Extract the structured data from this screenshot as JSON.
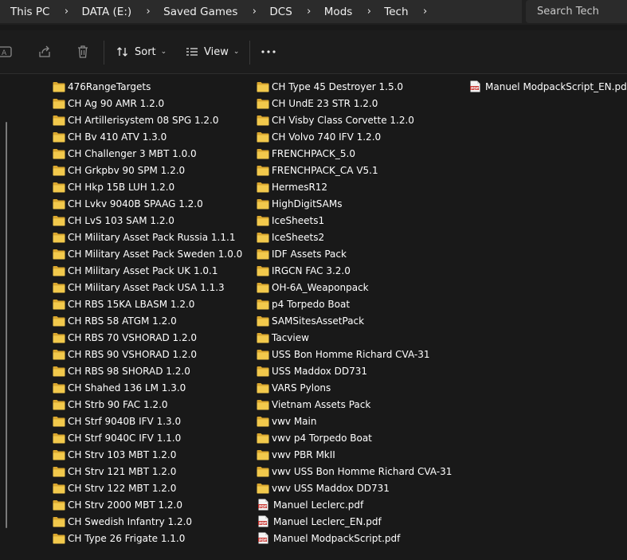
{
  "breadcrumb": [
    "This PC",
    "DATA (E:)",
    "Saved Games",
    "DCS",
    "Mods",
    "Tech"
  ],
  "search": {
    "placeholder": "Search Tech"
  },
  "toolbar": {
    "sort_label": "Sort",
    "view_label": "View",
    "more_label": "..."
  },
  "files": {
    "column1": [
      {
        "name": "476RangeTargets",
        "type": "folder"
      },
      {
        "name": "CH Ag 90 AMR 1.2.0",
        "type": "folder"
      },
      {
        "name": "CH Artillerisystem 08 SPG 1.2.0",
        "type": "folder"
      },
      {
        "name": "CH Bv 410 ATV 1.3.0",
        "type": "folder"
      },
      {
        "name": "CH Challenger 3 MBT 1.0.0",
        "type": "folder"
      },
      {
        "name": "CH Grkpbv 90 SPM 1.2.0",
        "type": "folder"
      },
      {
        "name": "CH Hkp 15B LUH 1.2.0",
        "type": "folder"
      },
      {
        "name": "CH Lvkv 9040B SPAAG 1.2.0",
        "type": "folder"
      },
      {
        "name": "CH LvS 103 SAM 1.2.0",
        "type": "folder"
      },
      {
        "name": "CH Military Asset Pack Russia 1.1.1",
        "type": "folder"
      },
      {
        "name": "CH Military Asset Pack Sweden 1.0.0",
        "type": "folder"
      },
      {
        "name": "CH Military Asset Pack UK 1.0.1",
        "type": "folder"
      },
      {
        "name": "CH Military Asset Pack USA 1.1.3",
        "type": "folder"
      },
      {
        "name": "CH RBS 15KA LBASM 1.2.0",
        "type": "folder"
      },
      {
        "name": "CH RBS 58 ATGM 1.2.0",
        "type": "folder"
      },
      {
        "name": "CH RBS 70 VSHORAD 1.2.0",
        "type": "folder"
      },
      {
        "name": "CH RBS 90 VSHORAD 1.2.0",
        "type": "folder"
      },
      {
        "name": "CH RBS 98 SHORAD 1.2.0",
        "type": "folder"
      },
      {
        "name": "CH Shahed 136 LM 1.3.0",
        "type": "folder"
      },
      {
        "name": "CH Strb 90 FAC 1.2.0",
        "type": "folder"
      },
      {
        "name": "CH Strf 9040B IFV 1.3.0",
        "type": "folder"
      },
      {
        "name": "CH Strf 9040C IFV 1.1.0",
        "type": "folder"
      },
      {
        "name": "CH Strv 103 MBT 1.2.0",
        "type": "folder"
      },
      {
        "name": "CH Strv 121 MBT 1.2.0",
        "type": "folder"
      },
      {
        "name": "CH Strv 122 MBT 1.2.0",
        "type": "folder"
      },
      {
        "name": "CH Strv 2000 MBT 1.2.0",
        "type": "folder"
      },
      {
        "name": "CH Swedish Infantry 1.2.0",
        "type": "folder"
      },
      {
        "name": "CH Type 26 Frigate 1.1.0",
        "type": "folder"
      }
    ],
    "column2": [
      {
        "name": "CH Type 45 Destroyer 1.5.0",
        "type": "folder"
      },
      {
        "name": "CH UndE 23 STR 1.2.0",
        "type": "folder"
      },
      {
        "name": "CH Visby Class Corvette 1.2.0",
        "type": "folder"
      },
      {
        "name": "CH Volvo 740 IFV 1.2.0",
        "type": "folder"
      },
      {
        "name": "FRENCHPACK_5.0",
        "type": "folder"
      },
      {
        "name": "FRENCHPACK_CA V5.1",
        "type": "folder"
      },
      {
        "name": "HermesR12",
        "type": "folder"
      },
      {
        "name": "HighDigitSAMs",
        "type": "folder"
      },
      {
        "name": "IceSheets1",
        "type": "folder"
      },
      {
        "name": "IceSheets2",
        "type": "folder"
      },
      {
        "name": "IDF Assets Pack",
        "type": "folder"
      },
      {
        "name": "IRGCN FAC 3.2.0",
        "type": "folder"
      },
      {
        "name": "OH-6A_Weaponpack",
        "type": "folder"
      },
      {
        "name": "p4 Torpedo Boat",
        "type": "folder"
      },
      {
        "name": "SAMSitesAssetPack",
        "type": "folder"
      },
      {
        "name": "Tacview",
        "type": "folder"
      },
      {
        "name": "USS Bon Homme Richard CVA-31",
        "type": "folder"
      },
      {
        "name": "USS Maddox DD731",
        "type": "folder"
      },
      {
        "name": "VARS Pylons",
        "type": "folder"
      },
      {
        "name": "Vietnam Assets Pack",
        "type": "folder"
      },
      {
        "name": "vwv Main",
        "type": "folder"
      },
      {
        "name": "vwv p4 Torpedo Boat",
        "type": "folder"
      },
      {
        "name": "vwv PBR MkII",
        "type": "folder"
      },
      {
        "name": "vwv USS Bon Homme Richard CVA-31",
        "type": "folder"
      },
      {
        "name": "vwv USS Maddox DD731",
        "type": "folder"
      },
      {
        "name": "Manuel Leclerc.pdf",
        "type": "pdf"
      },
      {
        "name": "Manuel Leclerc_EN.pdf",
        "type": "pdf"
      },
      {
        "name": "Manuel ModpackScript.pdf",
        "type": "pdf"
      }
    ],
    "column3": [
      {
        "name": "Manuel ModpackScript_EN.pdf",
        "type": "pdf"
      }
    ]
  },
  "colors": {
    "folder": "#f2c94c",
    "folder_dark": "#d9a62e",
    "pdf": "#c4302b",
    "background": "#191919"
  }
}
